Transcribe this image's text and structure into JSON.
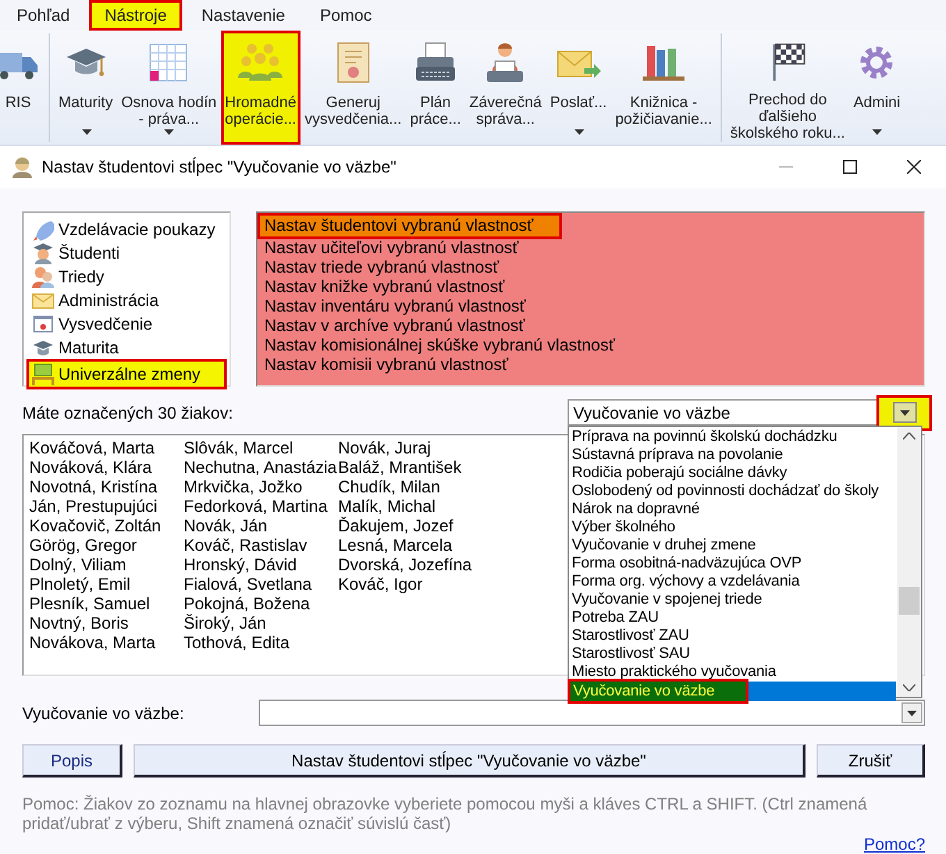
{
  "menu": [
    {
      "label": "Pohľad",
      "selected": false
    },
    {
      "label": "Nástroje",
      "selected": true
    },
    {
      "label": "Nastavenie",
      "selected": false
    },
    {
      "label": "Pomoc",
      "selected": false
    }
  ],
  "ribbon": [
    {
      "buttons": [
        {
          "label": "RIS",
          "dropdown": false,
          "selected": false
        }
      ]
    },
    {
      "buttons": [
        {
          "label": "Maturity",
          "dropdown": true,
          "selected": false
        },
        {
          "label": "Osnova hodín\n- práva...",
          "dropdown": true,
          "selected": false
        },
        {
          "label": "Hromadné\noperácie...",
          "dropdown": false,
          "selected": true
        },
        {
          "label": "Generuj\nvysvedčenia...",
          "dropdown": false,
          "selected": false
        },
        {
          "label": "Plán\npráce...",
          "dropdown": false,
          "selected": false
        },
        {
          "label": "Záverečná\nspráva...",
          "dropdown": false,
          "selected": false
        },
        {
          "label": "Poslať...",
          "dropdown": true,
          "selected": false
        },
        {
          "label": "Knižnica -\npožičiavanie...",
          "dropdown": false,
          "selected": false
        }
      ]
    },
    {
      "buttons": [
        {
          "label": "Prechod do\nďalšieho\nškolského roku...",
          "dropdown": false,
          "selected": false
        },
        {
          "label": "Admini",
          "dropdown": true,
          "selected": false
        }
      ]
    }
  ],
  "dialog": {
    "title": "Nastav študentovi stĺpec \"Vyučovanie vo väzbe\"",
    "categories": [
      {
        "label": "Vzdelávacie poukazy",
        "selected": false
      },
      {
        "label": "Študenti",
        "selected": false
      },
      {
        "label": "Triedy",
        "selected": false
      },
      {
        "label": "Administrácia",
        "selected": false
      },
      {
        "label": "Vysvedčenie",
        "selected": false
      },
      {
        "label": "Maturita",
        "selected": false
      },
      {
        "label": "Univerzálne zmeny",
        "selected": true
      }
    ],
    "actions": [
      {
        "label": "Nastav študentovi vybranú vlastnosť",
        "selected": true
      },
      {
        "label": "Nastav učiteľovi vybranú vlastnosť",
        "selected": false
      },
      {
        "label": "Nastav triede vybranú vlastnosť",
        "selected": false
      },
      {
        "label": "Nastav knižke vybranú vlastnosť",
        "selected": false
      },
      {
        "label": "Nastav inventáru vybranú vlastnosť",
        "selected": false
      },
      {
        "label": "Nastav v archíve vybranú vlastnosť",
        "selected": false
      },
      {
        "label": "Nastav komisionálnej skúške vybranú vlastnosť",
        "selected": false
      },
      {
        "label": "Nastav komisii vybranú vlastnosť",
        "selected": false
      }
    ],
    "count_label": "Máte označených 30 žiakov:",
    "column_combo": {
      "value": "Vyučovanie vo väzbe",
      "expanded": true,
      "options": [
        {
          "label": "Príprava na povinnú školskú dochádzku",
          "selected": false
        },
        {
          "label": "Sústavná príprava na povolanie",
          "selected": false
        },
        {
          "label": "Rodičia poberajú sociálne dávky",
          "selected": false
        },
        {
          "label": "Oslobodený od povinnosti dochádzať do školy",
          "selected": false
        },
        {
          "label": "Nárok na dopravné",
          "selected": false
        },
        {
          "label": "Výber školného",
          "selected": false
        },
        {
          "label": "Vyučovanie v druhej zmene",
          "selected": false
        },
        {
          "label": "Forma osobitná-nadväzujúca OVP",
          "selected": false
        },
        {
          "label": "Forma org. výchovy a vzdelávania",
          "selected": false
        },
        {
          "label": "Vyučovanie v spojenej triede",
          "selected": false
        },
        {
          "label": "Potreba ZAU",
          "selected": false
        },
        {
          "label": "Starostlivosť ZAU",
          "selected": false
        },
        {
          "label": "Starostlivosť SAU",
          "selected": false
        },
        {
          "label": "Miesto praktického vyučovania",
          "selected": false
        },
        {
          "label": "Vyučovanie vo väzbe",
          "selected": true
        }
      ]
    },
    "students": [
      "Kováčová, Marta",
      "Nováková, Klára",
      "Novotná, Kristína",
      "Ján, Prestupujúci",
      "Kovačovič, Zoltán",
      "Görög, Gregor",
      "Dolný, Viliam",
      "Plnoletý, Emil",
      "Plesník, Samuel",
      "Novtný, Boris",
      "Novákova, Marta",
      "Slôvák, Marcel",
      "Nechutna, Anastázia",
      "Mrkvička, Jožko",
      "Fedorková, Martina",
      "Novák, Ján",
      "Kováč, Rastislav",
      "Hronský, Dávid",
      "Fialová, Svetlana",
      "Pokojná, Božena",
      "Široký, Ján",
      "Tothová, Edita",
      "Novák, Juraj",
      "Baláž, Mrantišek",
      "Chudík, Milan",
      "Malík, Michal",
      "Ďakujem, Jozef",
      "Lesná, Marcela",
      "Dvorská, Jozefína",
      "Kováč, Igor"
    ],
    "value_field": {
      "label": "Vyučovanie vo väzbe:"
    },
    "buttons": [
      {
        "label": "Popis"
      },
      {
        "label": "Nastav študentovi stĺpec \"Vyučovanie vo väzbe\""
      },
      {
        "label": "Zrušiť"
      }
    ],
    "help": "Pomoc: Žiakov zo zoznamu na hlavnej obrazovke vyberiete pomocou myši a kláves CTRL a SHIFT. (Ctrl znamená pridať/ubrať z výberu, Shift znamená označiť súvislú časť)",
    "help_link": "Pomoc?"
  }
}
